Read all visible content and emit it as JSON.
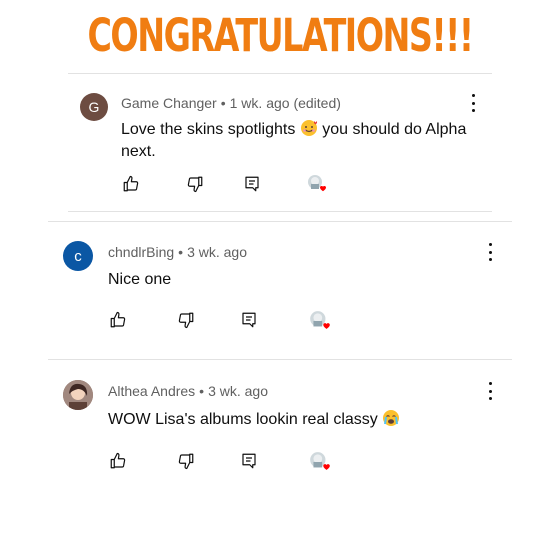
{
  "banner": "CONGRATULATIONS!!!",
  "comments": [
    {
      "avatar_letter": "G",
      "avatar_color": "#6d4c41",
      "author": "Game Changer",
      "time": "1 wk. ago (edited)",
      "text": "Love the skins spotlights",
      "text_after_emoji": " you should do Alpha next.",
      "emoji_icon": "smiling-face-with-hearts-icon"
    },
    {
      "avatar_letter": "c",
      "avatar_color": "#0b57a4",
      "author": "chndlrBing",
      "time": "3 wk. ago",
      "text": "Nice one"
    },
    {
      "avatar_letter": "",
      "avatar_color": "#8d6e63",
      "author": "Althea Andres",
      "time": "3 wk. ago",
      "text": "WOW Lisa's albums lookin real classy",
      "emoji_icon": "loudly-crying-face-icon"
    }
  ],
  "icons": {
    "like": "thumbs-up-icon",
    "dislike": "thumbs-down-icon",
    "reply": "reply-icon",
    "heart": "creator-heart-icon",
    "menu": "more-vert-icon"
  },
  "colors": {
    "banner": "#f07d12",
    "heart": "#ff0000",
    "meta": "#606060"
  }
}
